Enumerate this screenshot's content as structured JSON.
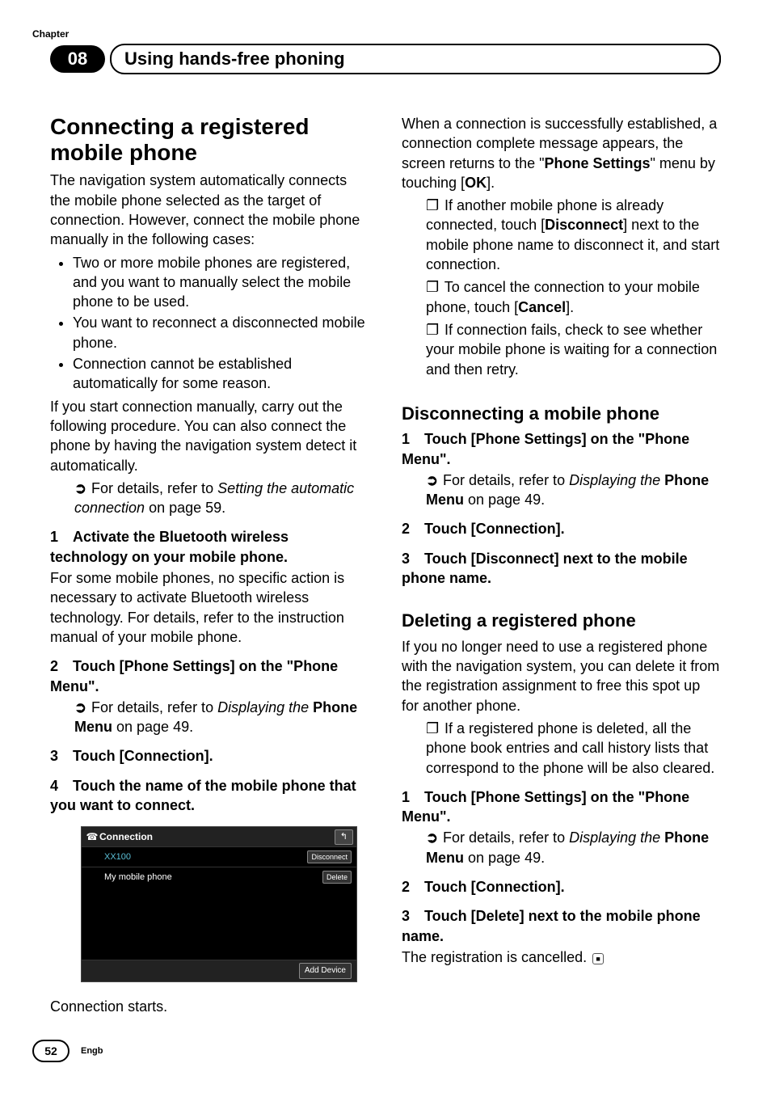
{
  "header": {
    "chapter_label": "Chapter",
    "chapter_num": "08",
    "title": "Using hands-free phoning"
  },
  "left": {
    "h1": "Connecting a registered mobile phone",
    "intro": "The navigation system automatically connects the mobile phone selected as the target of connection. However, connect the mobile phone manually in the following cases:",
    "bullets": [
      "Two or more mobile phones are registered, and you want to manually select the mobile phone to be used.",
      "You want to reconnect a disconnected mobile phone.",
      "Connection cannot be established automatically for some reason."
    ],
    "after_bullets": "If you start connection manually, carry out the following procedure. You can also connect the phone by having the navigation system detect it automatically.",
    "xref_prefix": "For details, refer to ",
    "xref_ital": "Setting the automatic connection",
    "xref_tail": " on page 59.",
    "step1_a": "1",
    "step1_b": "Activate the Bluetooth wireless technology on your mobile phone.",
    "step1_body": "For some mobile phones, no specific action is necessary to activate Bluetooth wireless technology. For details, refer to the instruction manual of your mobile phone.",
    "step2_a": "2",
    "step2_b": "Touch [Phone Settings] on the \"Phone Menu\".",
    "step2_xref_prefix": "For details, refer to ",
    "step2_xref_ital": "Displaying the ",
    "step2_xref_bold": "Phone Menu",
    "step2_xref_tail": " on page 49.",
    "step3_a": "3",
    "step3_b": "Touch [Connection].",
    "step4_a": "4",
    "step4_b": "Touch the name of the mobile phone that you want to connect.",
    "dev_title": "Connection",
    "dev_row1_name": "XX100",
    "dev_row1_btn": "Disconnect",
    "dev_row2_name": "My mobile phone",
    "dev_row2_btn": "Delete",
    "dev_footer_btn": "Add Device",
    "conn_starts": "Connection starts."
  },
  "right": {
    "para1_a": "When a connection is successfully established, a connection complete message appears, the screen returns to the \"",
    "para1_b": "Phone Settings",
    "para1_c": "\" menu by touching [",
    "para1_d": "OK",
    "para1_e": "].",
    "note1_a": "If another mobile phone is already connected, touch [",
    "note1_b": "Disconnect",
    "note1_c": "] next to the mobile phone name to disconnect it, and start connection.",
    "note2_a": "To cancel the connection to your mobile phone, touch [",
    "note2_b": "Cancel",
    "note2_c": "].",
    "note3": "If connection fails, check to see whether your mobile phone is waiting for a connection and then retry.",
    "disc_h2": "Disconnecting a mobile phone",
    "disc_s1_a": "1",
    "disc_s1_b": "Touch [Phone Settings] on the \"Phone Menu\".",
    "disc_xref_prefix": "For details, refer to ",
    "disc_xref_ital": "Displaying the ",
    "disc_xref_bold": "Phone Menu",
    "disc_xref_tail": " on page 49.",
    "disc_s2_a": "2",
    "disc_s2_b": "Touch [Connection].",
    "disc_s3_a": "3",
    "disc_s3_b": "Touch [Disconnect] next to the mobile phone name.",
    "del_h2": "Deleting a registered phone",
    "del_intro": "If you no longer need to use a registered phone with the navigation system, you can delete it from the registration assignment to free this spot up for another phone.",
    "del_note": "If a registered phone is deleted, all the phone book entries and call history lists that correspond to the phone will be also cleared.",
    "del_s1_a": "1",
    "del_s1_b": "Touch [Phone Settings] on the \"Phone Menu\".",
    "del_xref_prefix": "For details, refer to ",
    "del_xref_ital": "Displaying the ",
    "del_xref_bold": "Phone Menu",
    "del_xref_tail": " on page 49.",
    "del_s2_a": "2",
    "del_s2_b": "Touch [Connection].",
    "del_s3_a": "3",
    "del_s3_b": "Touch [Delete] next to the mobile phone name.",
    "del_tail": "The registration is cancelled."
  },
  "footer": {
    "page": "52",
    "lang": "Engb"
  },
  "glyphs": {
    "arrow": "➲",
    "note": "❐",
    "back": "↰",
    "phone": "☎",
    "end": "■"
  }
}
